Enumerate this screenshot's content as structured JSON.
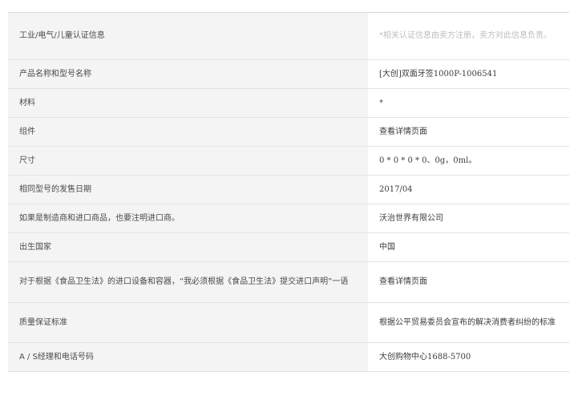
{
  "product_info": {
    "rows": [
      {
        "label": "工业/电气/儿童认证信息",
        "value": "*相关认证信息由卖方注册，卖方对此信息负责。",
        "style": "note"
      },
      {
        "label": "产品名称和型号名称",
        "value": "[大创]双面牙签1000P-1006541",
        "style": "normal"
      },
      {
        "label": "材料",
        "value": "*",
        "style": "normal"
      },
      {
        "label": "组件",
        "value": "查看详情页面",
        "style": "normal"
      },
      {
        "label": "尺寸",
        "value": "0 * 0 * 0 * 0、0g，0ml。",
        "style": "normal"
      },
      {
        "label": "相同型号的发售日期",
        "value": "2017/04",
        "style": "normal"
      },
      {
        "label": "如果是制造商和进口商品，也要注明进口商。",
        "value": "沃治世界有限公司",
        "style": "normal"
      },
      {
        "label": "出生国家",
        "value": "中国",
        "style": "normal"
      },
      {
        "label": "对于根据《食品卫生法》的进口设备和容器，“我必须根据《食品卫生法》提交进口声明”一语",
        "value": "查看详情页面",
        "style": "normal"
      },
      {
        "label": "质量保证标准",
        "value": "根据公平贸易委员会宣布的解决消费者纠纷的标准",
        "style": "normal"
      },
      {
        "label": "A / S经理和电话号码",
        "value": "大创购物中心1688-5700",
        "style": "normal"
      }
    ]
  },
  "colors": {
    "label_background": "#f4f4f4",
    "row_border": "#e3e3e3",
    "note_text": "#bdbdbd",
    "body_text": "#444444"
  }
}
